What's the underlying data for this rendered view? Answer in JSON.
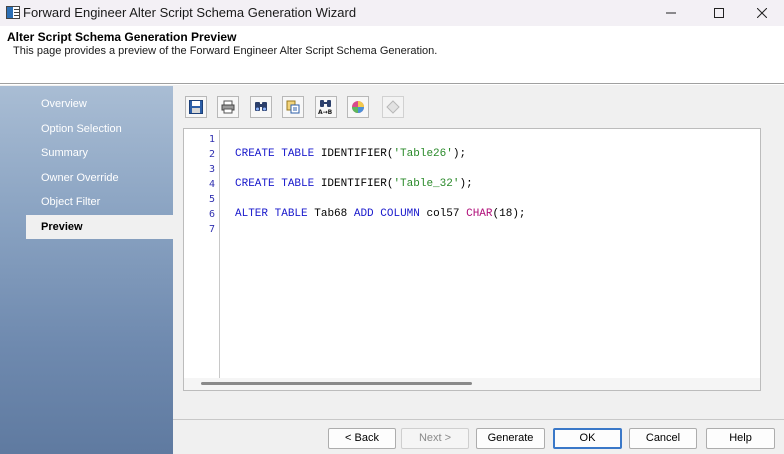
{
  "window": {
    "title": "Forward Engineer Alter Script Schema Generation Wizard"
  },
  "header": {
    "title": "Alter Script Schema Generation Preview",
    "description": "This page provides a preview of the Forward Engineer Alter Script Schema Generation."
  },
  "nav": {
    "items": [
      {
        "label": "Overview"
      },
      {
        "label": "Option Selection"
      },
      {
        "label": "Summary"
      },
      {
        "label": "Owner Override"
      },
      {
        "label": "Object Filter"
      },
      {
        "label": "Preview",
        "active": true
      }
    ]
  },
  "toolbar": {
    "icons": [
      "save-icon",
      "print-icon",
      "find-icon",
      "copy-icon",
      "find-replace-icon",
      "color-palette-icon",
      "clear-icon"
    ]
  },
  "editor": {
    "line_numbers": [
      "1",
      "2",
      "3",
      "4",
      "5",
      "6",
      "7"
    ],
    "lines": [
      {
        "n": "1",
        "tokens": []
      },
      {
        "n": "2",
        "tokens": [
          {
            "t": "CREATE",
            "c": "kw"
          },
          {
            "t": " "
          },
          {
            "t": "TABLE",
            "c": "kw"
          },
          {
            "t": " IDENTIFIER("
          },
          {
            "t": "'Table26'",
            "c": "str"
          },
          {
            "t": ");"
          }
        ]
      },
      {
        "n": "3",
        "tokens": []
      },
      {
        "n": "4",
        "tokens": [
          {
            "t": "CREATE",
            "c": "kw"
          },
          {
            "t": " "
          },
          {
            "t": "TABLE",
            "c": "kw"
          },
          {
            "t": " IDENTIFIER("
          },
          {
            "t": "'Table_32'",
            "c": "str"
          },
          {
            "t": ");"
          }
        ]
      },
      {
        "n": "5",
        "tokens": []
      },
      {
        "n": "6",
        "tokens": [
          {
            "t": "ALTER",
            "c": "kw"
          },
          {
            "t": " "
          },
          {
            "t": "TABLE",
            "c": "kw"
          },
          {
            "t": " Tab68 "
          },
          {
            "t": "ADD",
            "c": "kw"
          },
          {
            "t": " "
          },
          {
            "t": "COLUMN",
            "c": "kw"
          },
          {
            "t": " col57 "
          },
          {
            "t": "CHAR",
            "c": "typ"
          },
          {
            "t": "(18);"
          }
        ]
      },
      {
        "n": "7",
        "tokens": []
      }
    ]
  },
  "buttons": {
    "back": "< Back",
    "next": "Next >",
    "generate": "Generate",
    "ok": "OK",
    "cancel": "Cancel",
    "help": "Help"
  },
  "colors": {
    "keyword": "#1a1acc",
    "string": "#2a8a2a",
    "type": "#b0107a",
    "nav_gradient_top": "#a9bdd4",
    "nav_gradient_bottom": "#5f7aa0",
    "default_button_border": "#3a78c8"
  }
}
